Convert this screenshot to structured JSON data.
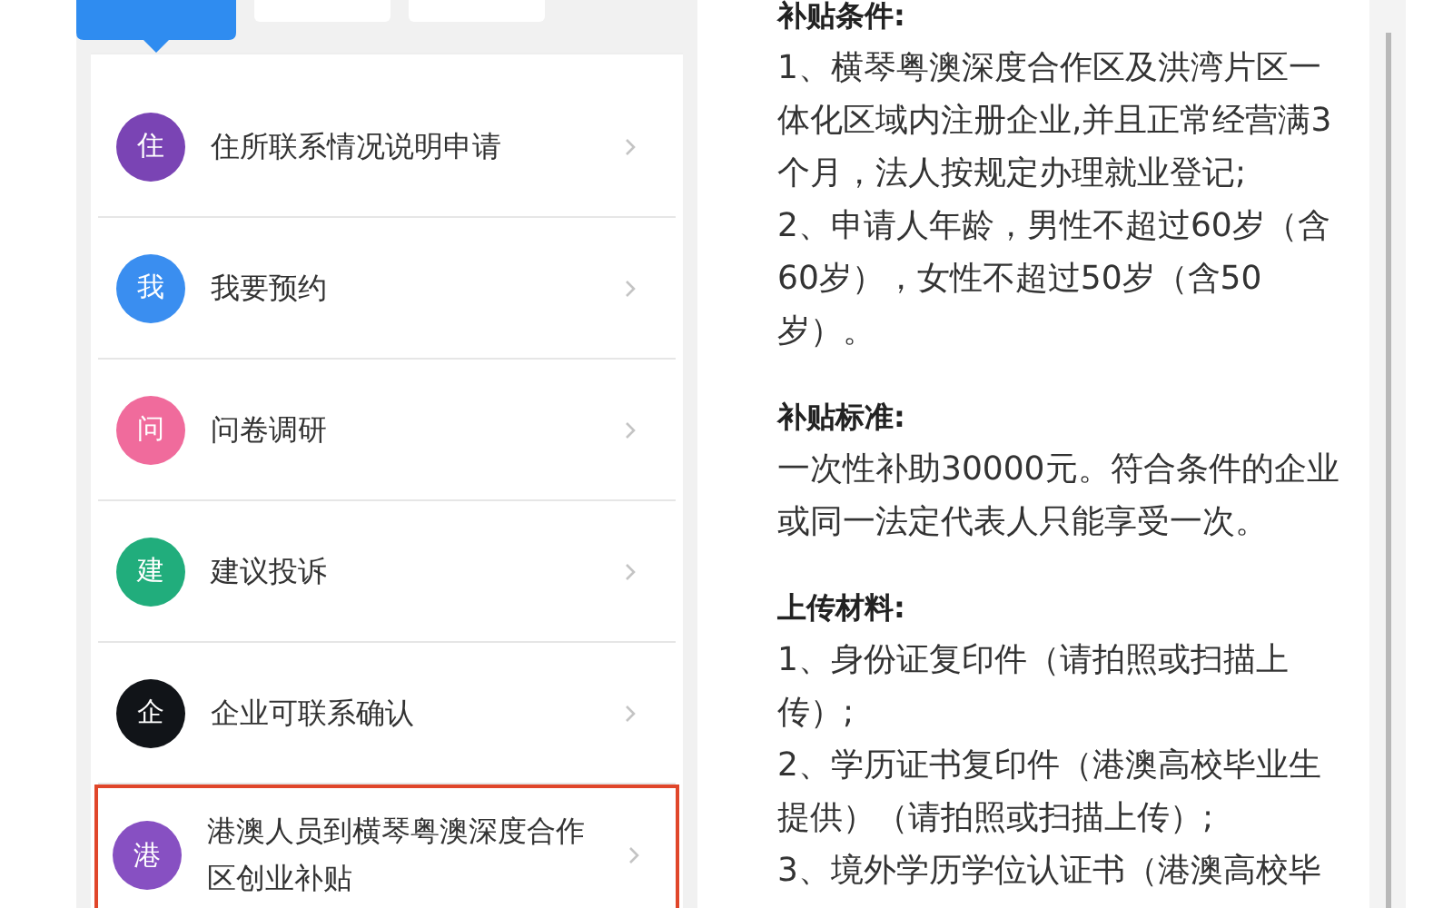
{
  "tabs": [
    {
      "selected": true
    },
    {
      "selected": false
    },
    {
      "selected": false
    }
  ],
  "services": [
    {
      "badge": "住",
      "label": "住所联系情况说明申请",
      "color": "#7a44b4",
      "selected": false
    },
    {
      "badge": "我",
      "label": "我要预约",
      "color": "#3a8ef0",
      "selected": false
    },
    {
      "badge": "问",
      "label": "问卷调研",
      "color": "#f06b9c",
      "selected": false
    },
    {
      "badge": "建",
      "label": "建议投诉",
      "color": "#21ad7c",
      "selected": false
    },
    {
      "badge": "企",
      "label": "企业可联系确认",
      "color": "#111418",
      "selected": false
    },
    {
      "badge": "港",
      "label": "港澳人员到横琴粤澳深度合作区创业补贴",
      "color": "#8750c2",
      "selected": true
    }
  ],
  "details": [
    {
      "heading": "补贴条件:",
      "paragraphs": [
        "1、横琴粤澳深度合作区及洪湾片区一体化区域内注册企业,并且正常经营满3个月，法人按规定办理就业登记;",
        "2、申请人年龄，男性不超过60岁（含60岁），女性不超过50岁（含50岁）。"
      ]
    },
    {
      "heading": "补贴标准:",
      "paragraphs": [
        "一次性补助30000元。符合条件的企业或同一法定代表人只能享受一次。"
      ]
    },
    {
      "heading": "上传材料:",
      "paragraphs": [
        "1、身份证复印件（请拍照或扫描上传）;",
        "2、学历证书复印件（港澳高校毕业生提供）（请拍照或扫描上传）;",
        "3、境外学历学位认证书（港澳高校毕"
      ]
    }
  ]
}
